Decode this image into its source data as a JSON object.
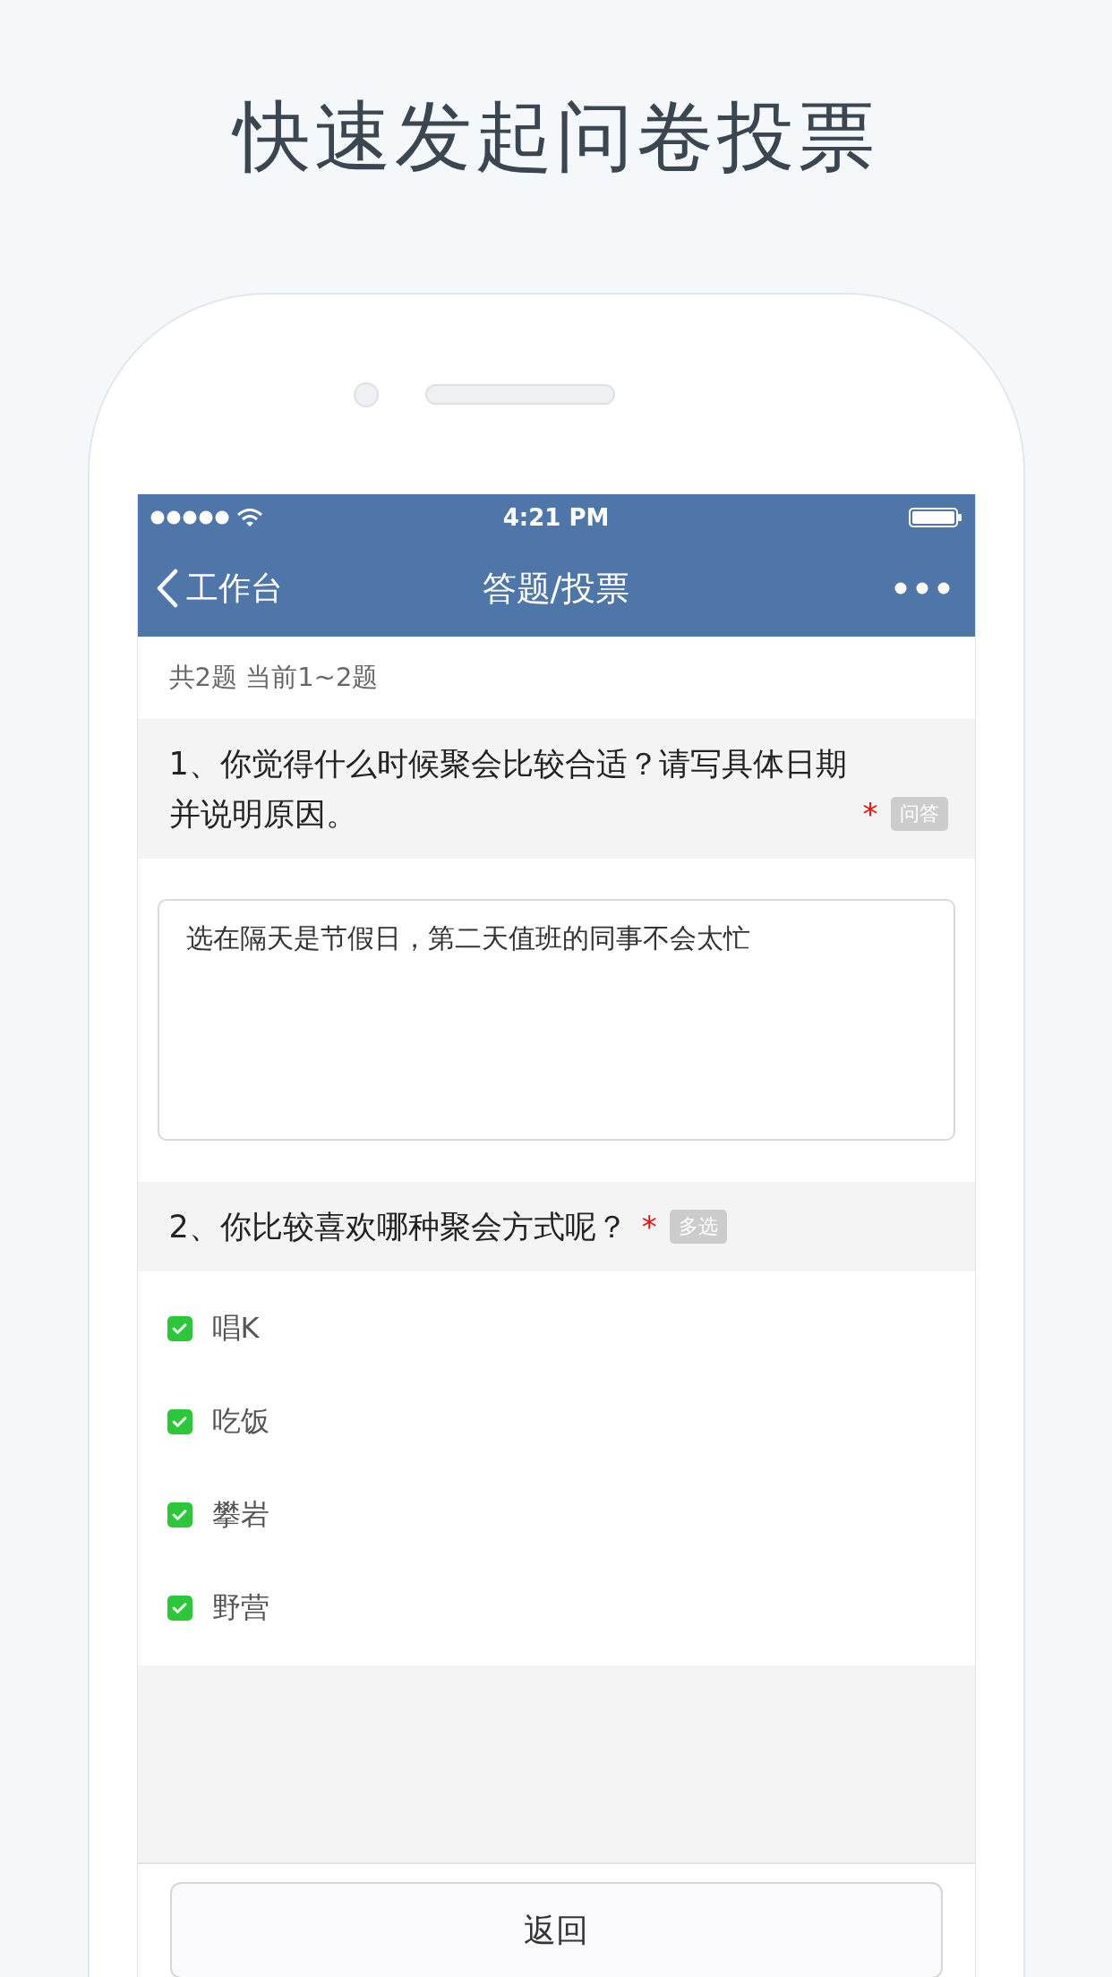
{
  "headline": "快速发起问卷投票",
  "status_bar": {
    "time": "4:21 PM"
  },
  "nav": {
    "back": "工作台",
    "title": "答题/投票"
  },
  "summary": "共2题 当前1~2题",
  "questions": [
    {
      "kind": "text",
      "title": "1、你觉得什么时候聚会比较合适？请写具体日期并说明原因。",
      "required_mark": "*",
      "tag": "问答",
      "answer": "选在隔天是节假日，第二天值班的同事不会太忙"
    },
    {
      "kind": "multi",
      "title": "2、你比较喜欢哪种聚会方式呢？",
      "required_mark": "*",
      "tag": "多选",
      "options": [
        {
          "label": "唱K",
          "checked": true
        },
        {
          "label": "吃饭",
          "checked": true
        },
        {
          "label": "攀岩",
          "checked": true
        },
        {
          "label": "野营",
          "checked": true
        }
      ]
    }
  ],
  "footer_button": "返回"
}
